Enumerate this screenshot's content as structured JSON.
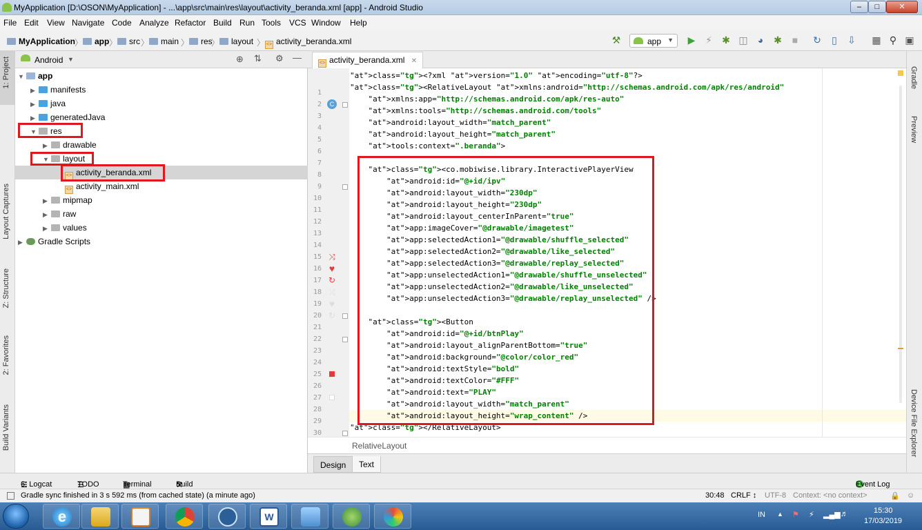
{
  "window": {
    "title": "MyApplication [D:\\OSON\\MyApplication] - ...\\app\\src\\main\\res\\layout\\activity_beranda.xml [app] - Android Studio",
    "minimize": "–",
    "maximize": "□",
    "close": "✕"
  },
  "menu": [
    "File",
    "Edit",
    "View",
    "Navigate",
    "Code",
    "Analyze",
    "Refactor",
    "Build",
    "Run",
    "Tools",
    "VCS",
    "Window",
    "Help"
  ],
  "breadcrumbs": [
    "MyApplication",
    "app",
    "src",
    "main",
    "res",
    "layout",
    "activity_beranda.xml"
  ],
  "run_config": {
    "label": "app"
  },
  "left_tool_tabs": [
    "1: Project",
    "Layout Captures",
    "Z: Structure",
    "2: Favorites",
    "Build Variants"
  ],
  "right_tool_tabs": [
    "Gradle",
    "Preview",
    "Device File Explorer"
  ],
  "project_panel": {
    "view_mode": "Android",
    "tree": [
      {
        "label": "app",
        "depth": 0,
        "expanded": true
      },
      {
        "label": "manifests",
        "depth": 1,
        "expanded": false
      },
      {
        "label": "java",
        "depth": 1,
        "expanded": false
      },
      {
        "label": "generatedJava",
        "depth": 1,
        "expanded": false
      },
      {
        "label": "res",
        "depth": 1,
        "expanded": true
      },
      {
        "label": "drawable",
        "depth": 2,
        "expanded": false
      },
      {
        "label": "layout",
        "depth": 2,
        "expanded": true
      },
      {
        "label": "activity_beranda.xml",
        "depth": 3,
        "selected": true
      },
      {
        "label": "activity_main.xml",
        "depth": 3
      },
      {
        "label": "mipmap",
        "depth": 2,
        "expanded": false
      },
      {
        "label": "raw",
        "depth": 2,
        "expanded": false
      },
      {
        "label": "values",
        "depth": 2,
        "expanded": false
      },
      {
        "label": "Gradle Scripts",
        "depth": 0,
        "expanded": false
      }
    ]
  },
  "editor": {
    "tab_label": "activity_beranda.xml",
    "breadcrumb": "RelativeLayout",
    "bottom_tabs": [
      "Design",
      "Text"
    ],
    "active_bottom_tab": "Text",
    "lines": [
      "<?xml version=\"1.0\" encoding=\"utf-8\"?>",
      "<RelativeLayout xmlns:android=\"http://schemas.android.com/apk/res/android\"",
      "    xmlns:app=\"http://schemas.android.com/apk/res-auto\"",
      "    xmlns:tools=\"http://schemas.android.com/tools\"",
      "    android:layout_width=\"match_parent\"",
      "    android:layout_height=\"match_parent\"",
      "    tools:context=\".beranda\">",
      "",
      "    <co.mobiwise.library.InteractivePlayerView",
      "        android:id=\"@+id/ipv\"",
      "        android:layout_width=\"230dp\"",
      "        android:layout_height=\"230dp\"",
      "        android:layout_centerInParent=\"true\"",
      "        app:imageCover=\"@drawable/imagetest\"",
      "        app:selectedAction1=\"@drawable/shuffle_selected\"",
      "        app:selectedAction2=\"@drawable/like_selected\"",
      "        app:selectedAction3=\"@drawable/replay_selected\"",
      "        app:unselectedAction1=\"@drawable/shuffle_unselected\"",
      "        app:unselectedAction2=\"@drawable/like_unselected\"",
      "        app:unselectedAction3=\"@drawable/replay_unselected\" />",
      "",
      "    <Button",
      "        android:id=\"@+id/btnPlay\"",
      "        android:layout_alignParentBottom=\"true\"",
      "        android:background=\"@color/color_red\"",
      "        android:textStyle=\"bold\"",
      "        android:textColor=\"#FFF\"",
      "        android:text=\"PLAY\"",
      "        android:layout_width=\"match_parent\"",
      "        android:layout_height=\"wrap_content\" />",
      "</RelativeLayout>"
    ],
    "line_numbers": [
      "1",
      "2",
      "3",
      "4",
      "5",
      "6",
      "7",
      "8",
      "9",
      "10",
      "11",
      "12",
      "13",
      "14",
      "15",
      "16",
      "17",
      "18",
      "19",
      "20",
      "21",
      "22",
      "23",
      "24",
      "25",
      "26",
      "27",
      "28",
      "29",
      "30",
      "31"
    ]
  },
  "bottom_tools": [
    "6: Logcat",
    "TODO",
    "Terminal",
    "Build",
    "Event Log"
  ],
  "status": {
    "message": "Gradle sync finished in 3 s 592 ms (from cached state) (a minute ago)",
    "position": "30:48",
    "line_sep": "CRLF ↕",
    "encoding": "UTF-8",
    "context": "Context: <no context>"
  },
  "taskbar": {
    "lang": "IN",
    "time": "15:30",
    "date": "17/03/2019"
  },
  "colors": {
    "highlight_red": "#e1161f",
    "selection": "#d5d5d5",
    "xml_tag": "#000080",
    "xml_attr": "#0000ff",
    "xml_value": "#008000"
  }
}
